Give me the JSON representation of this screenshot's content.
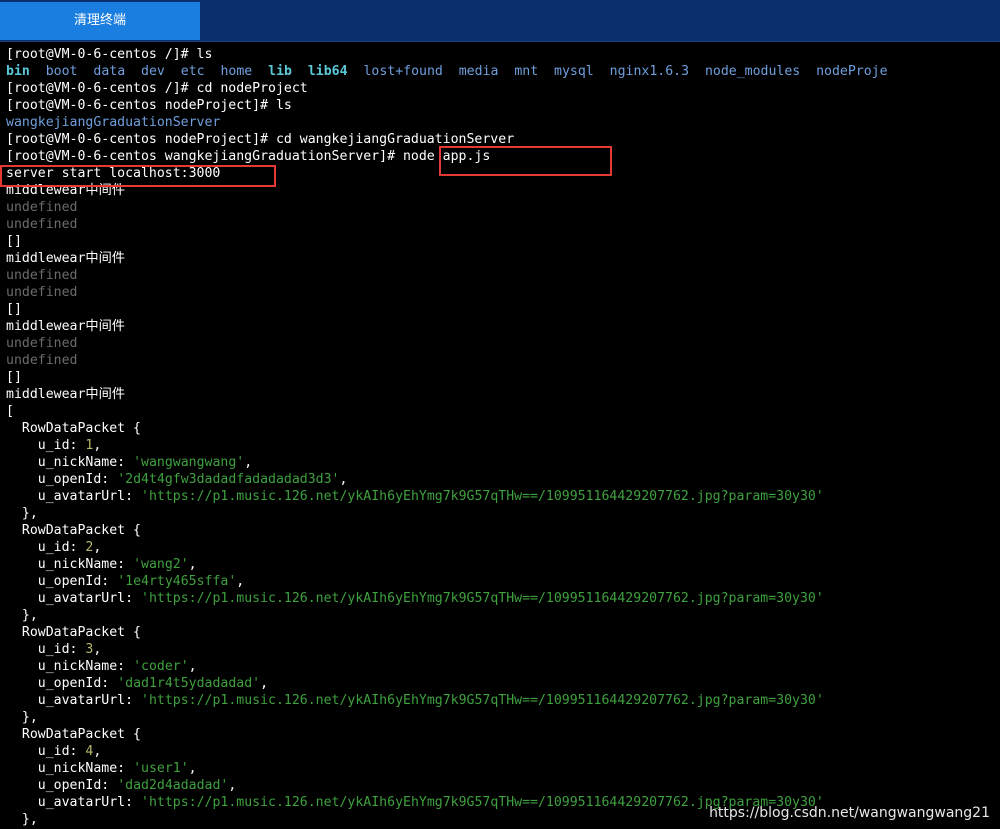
{
  "toolbar": {
    "clear_label": "清理终端"
  },
  "watermark": "https://blog.csdn.net/wangwangwang21",
  "terminal": {
    "lines": [
      {
        "kind": "plain",
        "text": "[root@VM-0-6-centos /]# ls"
      },
      {
        "kind": "ls",
        "items": [
          {
            "t": "bin",
            "c": "dir-bold"
          },
          {
            "t": "boot",
            "c": "dir"
          },
          {
            "t": "data",
            "c": "dir"
          },
          {
            "t": "dev",
            "c": "dir"
          },
          {
            "t": "etc",
            "c": "dir"
          },
          {
            "t": "home",
            "c": "dir"
          },
          {
            "t": "lib",
            "c": "dir-bold"
          },
          {
            "t": "lib64",
            "c": "dir-bold"
          },
          {
            "t": "lost+found",
            "c": "dir"
          },
          {
            "t": "media",
            "c": "dir"
          },
          {
            "t": "mnt",
            "c": "dir"
          },
          {
            "t": "mysql",
            "c": "dir"
          },
          {
            "t": "nginx1.6.3",
            "c": "dir"
          },
          {
            "t": "node_modules",
            "c": "dir"
          },
          {
            "t": "nodeProje",
            "c": "dir"
          }
        ]
      },
      {
        "kind": "plain",
        "text": "[root@VM-0-6-centos /]# cd nodeProject"
      },
      {
        "kind": "plain",
        "text": "[root@VM-0-6-centos nodeProject]# ls"
      },
      {
        "kind": "colored",
        "text": "wangkejiangGraduationServer",
        "c": "dir"
      },
      {
        "kind": "plain",
        "text": "[root@VM-0-6-centos nodeProject]# cd wangkejiangGraduationServer"
      },
      {
        "kind": "plain",
        "text": "[root@VM-0-6-centos wangkejiangGraduationServer]# node app.js"
      },
      {
        "kind": "plain",
        "text": "server start localhost:3000"
      },
      {
        "kind": "plain",
        "text": "middlewear中间件"
      },
      {
        "kind": "colored",
        "text": "undefined",
        "c": "gray"
      },
      {
        "kind": "colored",
        "text": "undefined",
        "c": "gray"
      },
      {
        "kind": "plain",
        "text": "[]"
      },
      {
        "kind": "plain",
        "text": "middlewear中间件"
      },
      {
        "kind": "colored",
        "text": "undefined",
        "c": "gray"
      },
      {
        "kind": "colored",
        "text": "undefined",
        "c": "gray"
      },
      {
        "kind": "plain",
        "text": "[]"
      },
      {
        "kind": "plain",
        "text": "middlewear中间件"
      },
      {
        "kind": "colored",
        "text": "undefined",
        "c": "gray"
      },
      {
        "kind": "colored",
        "text": "undefined",
        "c": "gray"
      },
      {
        "kind": "plain",
        "text": "[]"
      },
      {
        "kind": "plain",
        "text": "middlewear中间件"
      },
      {
        "kind": "plain",
        "text": "["
      },
      {
        "kind": "plain",
        "text": "  RowDataPacket {"
      },
      {
        "kind": "kv",
        "indent": "    ",
        "key": "u_id",
        "val": "1",
        "vc": "num",
        "tail": ","
      },
      {
        "kind": "kv",
        "indent": "    ",
        "key": "u_nickName",
        "val": "'wangwangwang'",
        "vc": "str",
        "tail": ","
      },
      {
        "kind": "kv",
        "indent": "    ",
        "key": "u_openId",
        "val": "'2d4t4gfw3dadadfadadadad3d3'",
        "vc": "str",
        "tail": ","
      },
      {
        "kind": "kv",
        "indent": "    ",
        "key": "u_avatarUrl",
        "val": "'https://p1.music.126.net/ykAIh6yEhYmg7k9G57qTHw==/109951164429207762.jpg?param=30y30'",
        "vc": "str",
        "tail": ""
      },
      {
        "kind": "plain",
        "text": "  },"
      },
      {
        "kind": "plain",
        "text": "  RowDataPacket {"
      },
      {
        "kind": "kv",
        "indent": "    ",
        "key": "u_id",
        "val": "2",
        "vc": "num",
        "tail": ","
      },
      {
        "kind": "kv",
        "indent": "    ",
        "key": "u_nickName",
        "val": "'wang2'",
        "vc": "str",
        "tail": ","
      },
      {
        "kind": "kv",
        "indent": "    ",
        "key": "u_openId",
        "val": "'1e4rty465sffa'",
        "vc": "str",
        "tail": ","
      },
      {
        "kind": "kv",
        "indent": "    ",
        "key": "u_avatarUrl",
        "val": "'https://p1.music.126.net/ykAIh6yEhYmg7k9G57qTHw==/109951164429207762.jpg?param=30y30'",
        "vc": "str",
        "tail": ""
      },
      {
        "kind": "plain",
        "text": "  },"
      },
      {
        "kind": "plain",
        "text": "  RowDataPacket {"
      },
      {
        "kind": "kv",
        "indent": "    ",
        "key": "u_id",
        "val": "3",
        "vc": "num",
        "tail": ","
      },
      {
        "kind": "kv",
        "indent": "    ",
        "key": "u_nickName",
        "val": "'coder'",
        "vc": "str",
        "tail": ","
      },
      {
        "kind": "kv",
        "indent": "    ",
        "key": "u_openId",
        "val": "'dad1r4t5ydadadad'",
        "vc": "str",
        "tail": ","
      },
      {
        "kind": "kv",
        "indent": "    ",
        "key": "u_avatarUrl",
        "val": "'https://p1.music.126.net/ykAIh6yEhYmg7k9G57qTHw==/109951164429207762.jpg?param=30y30'",
        "vc": "str",
        "tail": ""
      },
      {
        "kind": "plain",
        "text": "  },"
      },
      {
        "kind": "plain",
        "text": "  RowDataPacket {"
      },
      {
        "kind": "kv",
        "indent": "    ",
        "key": "u_id",
        "val": "4",
        "vc": "num",
        "tail": ","
      },
      {
        "kind": "kv",
        "indent": "    ",
        "key": "u_nickName",
        "val": "'user1'",
        "vc": "str",
        "tail": ","
      },
      {
        "kind": "kv",
        "indent": "    ",
        "key": "u_openId",
        "val": "'dad2d4adadad'",
        "vc": "str",
        "tail": ","
      },
      {
        "kind": "kv",
        "indent": "    ",
        "key": "u_avatarUrl",
        "val": "'https://p1.music.126.net/ykAIh6yEhYmg7k9G57qTHw==/109951164429207762.jpg?param=30y30'",
        "vc": "str",
        "tail": ""
      },
      {
        "kind": "plain",
        "text": "  },"
      }
    ]
  },
  "colors": {
    "toolbar_bg": "#0a2e6b",
    "button_bg": "#1a7de0",
    "highlight": "#e53935"
  }
}
